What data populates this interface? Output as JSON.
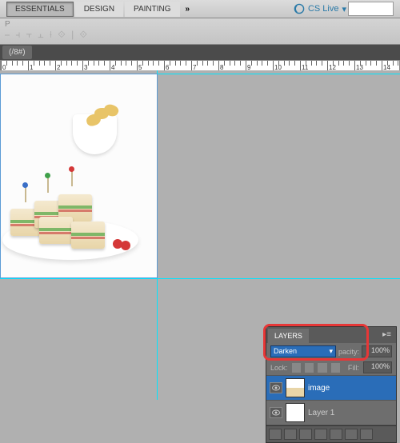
{
  "menubar": {
    "workspaces": [
      "ESSENTIALS",
      "DESIGN",
      "PAINTING"
    ],
    "active_workspace": 0,
    "chevron": "»",
    "cslive": "CS Live"
  },
  "doc_tab": "(/8#)",
  "ruler": {
    "marks": [
      "0",
      "1",
      "2",
      "3",
      "4",
      "5",
      "6",
      "7",
      "8",
      "9",
      "10",
      "11",
      "12",
      "13",
      "14"
    ]
  },
  "layers_panel": {
    "tab": "LAYERS",
    "blend_mode": "Darken",
    "opacity_label": "pacity:",
    "opacity_value": "100%",
    "lock_label": "Lock:",
    "fill_label": "Fill:",
    "fill_value": "100%",
    "layers": [
      {
        "name": "image",
        "selected": true
      },
      {
        "name": "Layer 1",
        "selected": false
      }
    ]
  }
}
